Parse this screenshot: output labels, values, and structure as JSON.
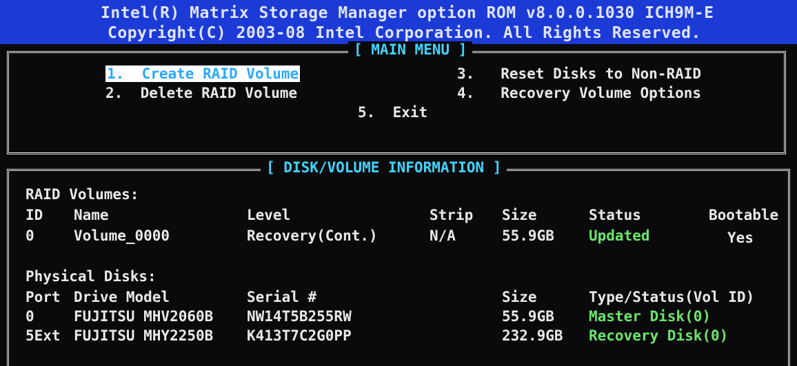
{
  "header": {
    "line1": "Intel(R) Matrix Storage Manager option ROM v8.0.0.1030 ICH9M-E",
    "line2": "Copyright(C) 2003-08 Intel Corporation.  All Rights Reserved."
  },
  "main_menu": {
    "title": "[ MAIN MENU ]",
    "items": [
      {
        "num": "1.",
        "label": "Create RAID Volume"
      },
      {
        "num": "2.",
        "label": "Delete RAID Volume"
      },
      {
        "num": "3.",
        "label": "Reset Disks to Non-RAID"
      },
      {
        "num": "4.",
        "label": "Recovery Volume Options"
      },
      {
        "num": "5.",
        "label": "Exit"
      }
    ],
    "selected_index": 0
  },
  "disk_info": {
    "title": "[ DISK/VOLUME INFORMATION ]",
    "raid_volumes_label": "RAID Volumes:",
    "volume_headers": {
      "id": "ID",
      "name": "Name",
      "level": "Level",
      "strip": "Strip",
      "size": "Size",
      "status": "Status",
      "bootable": "Bootable"
    },
    "volumes": [
      {
        "id": "0",
        "name": "Volume_0000",
        "level": "Recovery(Cont.)",
        "strip": "N/A",
        "size": "55.9GB",
        "status": "Updated",
        "bootable": "Yes"
      }
    ],
    "physical_disks_label": "Physical Disks:",
    "disk_headers": {
      "port": "Port",
      "model": "Drive Model",
      "serial": "Serial #",
      "size": "Size",
      "type": "Type/Status(Vol ID)"
    },
    "disks": [
      {
        "port": "0",
        "model": "FUJITSU MHV2060B",
        "serial": "NW14T5B255RW",
        "size": "55.9GB",
        "type": "Master Disk(0)"
      },
      {
        "port": "5Ext",
        "model": "FUJITSU MHY2250B",
        "serial": "K413T7C2G0PP",
        "size": "232.9GB",
        "type": "Recovery Disk(0)"
      }
    ]
  },
  "colors": {
    "header_bg": "#1c3bd6",
    "screen_bg": "#0a0a0c",
    "title_cyan": "#3fd6ff",
    "status_green": "#6be56b",
    "text": "#e9e9e9"
  }
}
